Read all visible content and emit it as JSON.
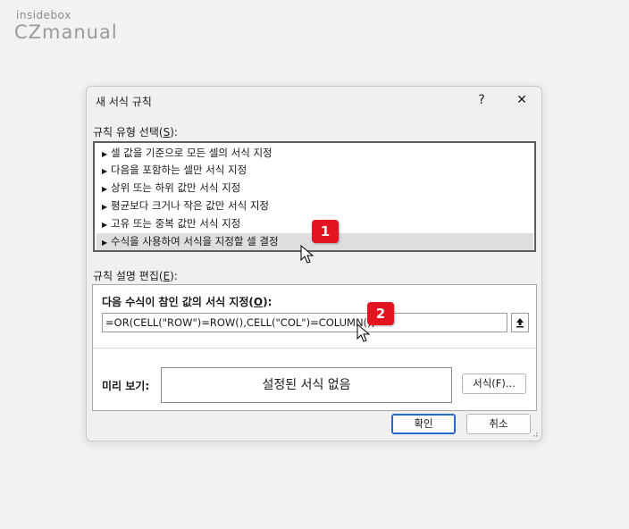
{
  "watermark": {
    "line1": "insidebox",
    "line2": "CZmanual"
  },
  "dialog": {
    "title": "새 서식 규칙",
    "help_label": "?",
    "close_label": "✕",
    "rule_type_label": "규칙 유형 선택(",
    "rule_type_accel": "S",
    "rule_type_suffix": "):",
    "rule_types": [
      "셀 값을 기준으로 모든 셀의 서식 지정",
      "다음을 포함하는 셀만 서식 지정",
      "상위 또는 하위 값만 서식 지정",
      "평균보다 크거나 작은 값만 서식 지정",
      "고유 또는 중복 값만 서식 지정",
      "수식을 사용하여 서식을 지정할 셀 결정"
    ],
    "selected_rule_index": 5,
    "edit_label": "규칙 설명 편집(",
    "edit_accel": "E",
    "edit_suffix": "):",
    "formula_heading": "다음 수식이 참인 값의 서식 지정(",
    "formula_accel": "O",
    "formula_suffix": "):",
    "formula_value": "=OR(CELL(\"ROW\")=ROW(),CELL(\"COL\")=COLUMN())",
    "preview_label": "미리 보기:",
    "preview_text": "설정된 서식 없음",
    "format_button": "서식(F)...",
    "ok_button": "확인",
    "cancel_button": "취소"
  },
  "badges": {
    "step1": "1",
    "step2": "2"
  },
  "colors": {
    "badge": "#e3131f",
    "primary_border": "#2a68c8"
  }
}
